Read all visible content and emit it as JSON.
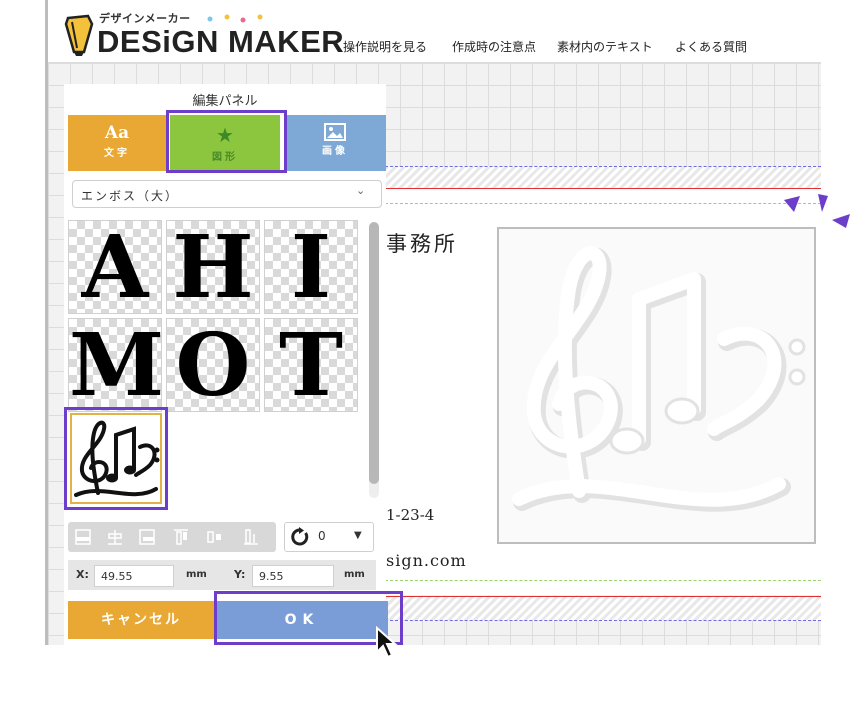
{
  "brand": {
    "logo_small": "デザインメーカー",
    "logo_main": "DESiGN MAKER"
  },
  "nav": [
    "操作説明を見る",
    "作成時の注意点",
    "素材内のテキスト",
    "よくある質問"
  ],
  "panel": {
    "title": "編集パネル",
    "tabs": [
      {
        "icon": "Aa",
        "label": "文字"
      },
      {
        "icon": "★",
        "label": "図形"
      },
      {
        "icon": "image-icon",
        "label": "画像"
      }
    ],
    "dropdown_value": "エンボス（大）",
    "tiles": [
      "A",
      "H",
      "I",
      "M",
      "O",
      "T"
    ],
    "rotate_value": "0",
    "x_label": "X:",
    "x_value": "49.55",
    "x_unit": "mm",
    "y_label": "Y:",
    "y_value": "9.55",
    "y_unit": "mm",
    "cancel_label": "キャンセル",
    "ok_label": "OK"
  },
  "card": {
    "office_fragment": "事務所",
    "address_fragment": "1-23-4",
    "email_fragment": "sign.com"
  },
  "colors": {
    "text_tab": "#e9a733",
    "shape_tab": "#8cc63f",
    "image_tab": "#7ea9d6",
    "ok": "#7b9dd7",
    "highlight": "#6c3ec9"
  }
}
